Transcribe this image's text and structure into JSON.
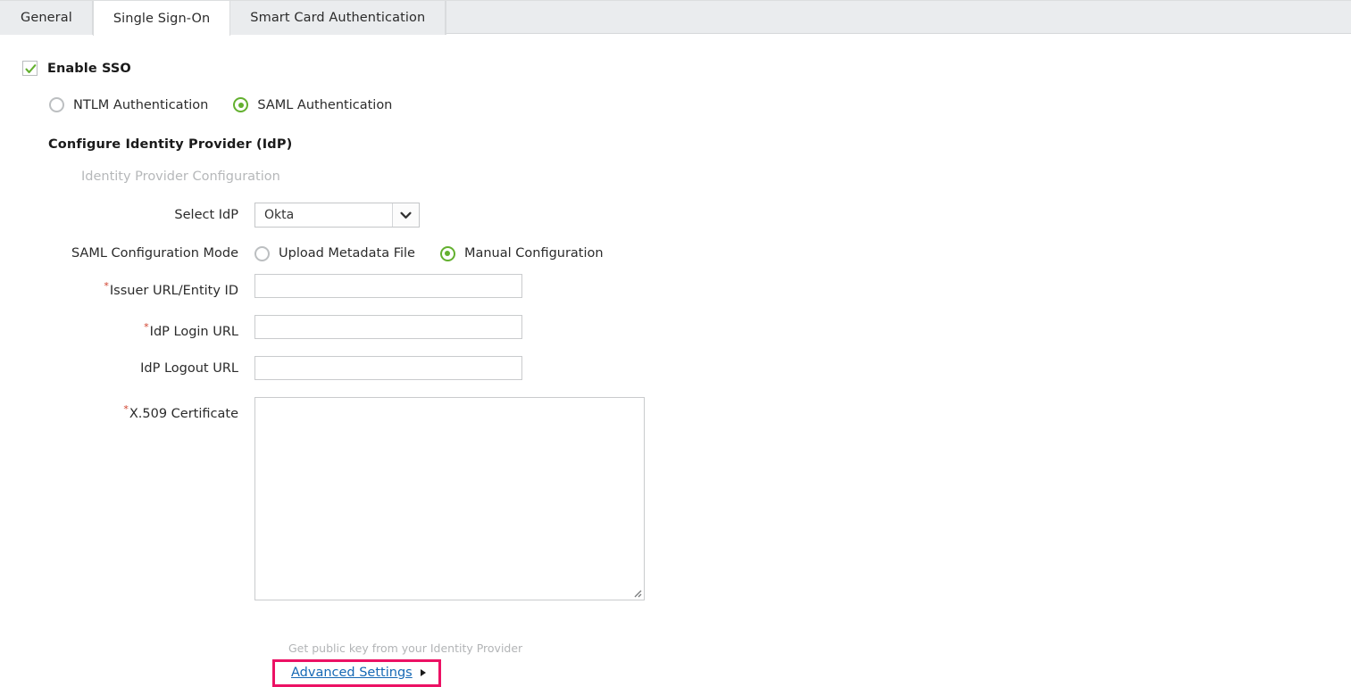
{
  "tabs": [
    {
      "label": "General",
      "active": false
    },
    {
      "label": "Single Sign-On",
      "active": true
    },
    {
      "label": "Smart Card Authentication",
      "active": false
    }
  ],
  "enable_sso": {
    "label": "Enable SSO",
    "checked": true
  },
  "auth_mode": {
    "options": [
      {
        "label": "NTLM Authentication",
        "selected": false
      },
      {
        "label": "SAML Authentication",
        "selected": true
      }
    ]
  },
  "idp_section": {
    "title": "Configure Identity Provider (IdP)",
    "subtitle": "Identity Provider Configuration"
  },
  "fields": {
    "select_idp": {
      "label": "Select IdP",
      "value": "Okta",
      "required": false
    },
    "saml_mode": {
      "label": "SAML Configuration Mode",
      "options": [
        {
          "label": "Upload Metadata File",
          "selected": false
        },
        {
          "label": "Manual Configuration",
          "selected": true
        }
      ]
    },
    "issuer_url": {
      "label": "Issuer URL/Entity ID",
      "value": "",
      "required": true,
      "required_mark": "*"
    },
    "idp_login_url": {
      "label": "IdP Login URL",
      "value": "",
      "required": true,
      "required_mark": "*"
    },
    "idp_logout_url": {
      "label": "IdP Logout URL",
      "value": "",
      "required": false
    },
    "x509_certificate": {
      "label": "X.509 Certificate",
      "value": "",
      "required": true,
      "required_mark": "*",
      "helper": "Get public key from your Identity Provider"
    }
  },
  "advanced_settings": {
    "label": "Advanced Settings",
    "highlighted": true
  },
  "colors": {
    "accent_green": "#63b02f",
    "highlight_pink": "#ec1164",
    "link_blue": "#1669b5",
    "required_red": "#d0402c",
    "tab_bg": "#eaecee"
  }
}
